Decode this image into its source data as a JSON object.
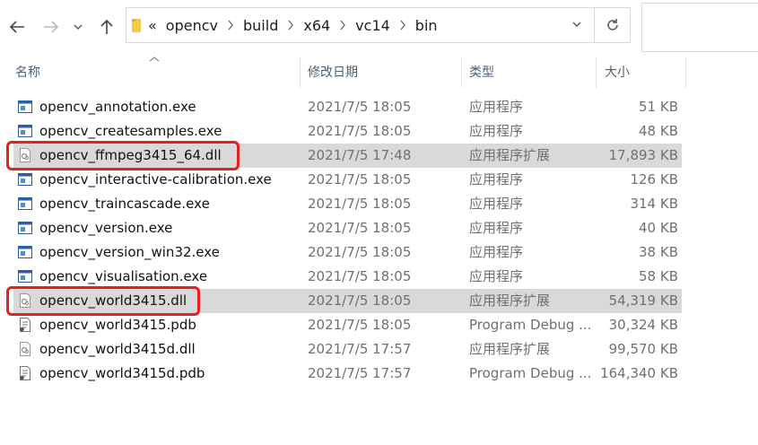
{
  "nav": {
    "back_icon": "arrow-left-icon",
    "forward_icon": "arrow-right-icon",
    "recent_icon": "chevron-down-icon",
    "up_icon": "arrow-up-icon",
    "overflow": "«",
    "path": [
      "opencv",
      "build",
      "x64",
      "vc14",
      "bin"
    ],
    "refresh_icon": "refresh-icon"
  },
  "columns": {
    "name": "名称",
    "date": "修改日期",
    "type": "类型",
    "size": "大小"
  },
  "files": [
    {
      "name": "opencv_annotation.exe",
      "date": "2021/7/5 18:05",
      "type": "应用程序",
      "size": "51 KB",
      "icon": "exe-icon"
    },
    {
      "name": "opencv_createsamples.exe",
      "date": "2021/7/5 18:05",
      "type": "应用程序",
      "size": "48 KB",
      "icon": "exe-icon"
    },
    {
      "name": "opencv_ffmpeg3415_64.dll",
      "date": "2021/7/5 17:48",
      "type": "应用程序扩展",
      "size": "17,893 KB",
      "icon": "dll-icon",
      "selected": true
    },
    {
      "name": "opencv_interactive-calibration.exe",
      "date": "2021/7/5 18:05",
      "type": "应用程序",
      "size": "126 KB",
      "icon": "exe-icon"
    },
    {
      "name": "opencv_traincascade.exe",
      "date": "2021/7/5 18:05",
      "type": "应用程序",
      "size": "314 KB",
      "icon": "exe-icon"
    },
    {
      "name": "opencv_version.exe",
      "date": "2021/7/5 18:05",
      "type": "应用程序",
      "size": "40 KB",
      "icon": "exe-icon"
    },
    {
      "name": "opencv_version_win32.exe",
      "date": "2021/7/5 18:05",
      "type": "应用程序",
      "size": "38 KB",
      "icon": "exe-icon"
    },
    {
      "name": "opencv_visualisation.exe",
      "date": "2021/7/5 18:05",
      "type": "应用程序",
      "size": "58 KB",
      "icon": "exe-icon"
    },
    {
      "name": "opencv_world3415.dll",
      "date": "2021/7/5 18:05",
      "type": "应用程序扩展",
      "size": "54,319 KB",
      "icon": "dll-icon",
      "selected": true
    },
    {
      "name": "opencv_world3415.pdb",
      "date": "2021/7/5 18:05",
      "type": "Program Debug ...",
      "size": "30,324 KB",
      "icon": "pdb-icon"
    },
    {
      "name": "opencv_world3415d.dll",
      "date": "2021/7/5 17:57",
      "type": "应用程序扩展",
      "size": "99,570 KB",
      "icon": "dll-icon"
    },
    {
      "name": "opencv_world3415d.pdb",
      "date": "2021/7/5 17:57",
      "type": "Program Debug ...",
      "size": "164,340 KB",
      "icon": "pdb-icon"
    }
  ],
  "highlighted_files": [
    "opencv_ffmpeg3415_64.dll",
    "opencv_world3415.dll"
  ],
  "colors": {
    "highlight": "#e8201c",
    "selection": "#d9d9d9",
    "header_text": "#4c607a",
    "folder": "#f7c948"
  }
}
